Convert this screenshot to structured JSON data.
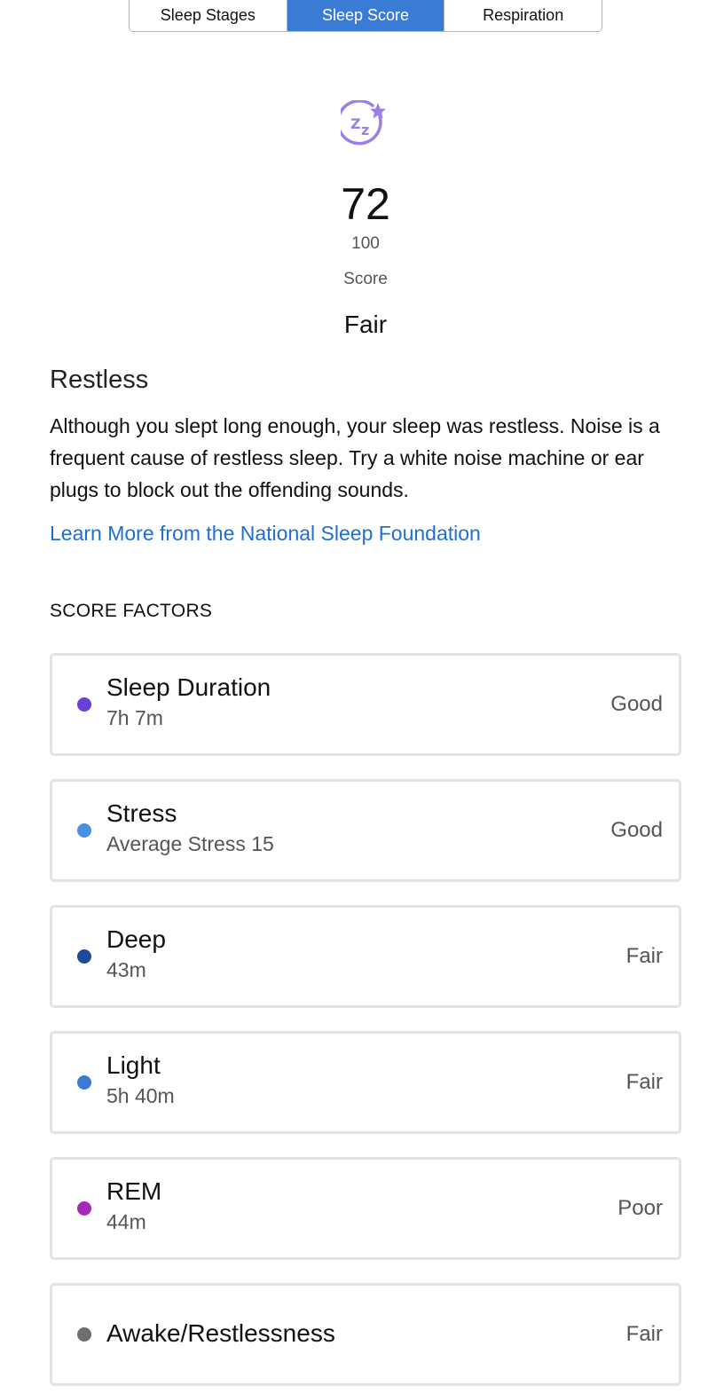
{
  "tabs": [
    {
      "label": "Sleep Stages",
      "active": false
    },
    {
      "label": "Sleep Score",
      "active": true
    },
    {
      "label": "Respiration",
      "active": false
    }
  ],
  "score": {
    "icon": "sleep-zz-star-icon",
    "value": "72",
    "max": "100",
    "label": "Score",
    "quality": "Fair"
  },
  "insight": {
    "title": "Restless",
    "body": "Although you slept long enough, your sleep was restless. Noise is a frequent cause of restless sleep. Try a white noise machine or ear plugs to block out the offending sounds.",
    "link": "Learn More from the National Sleep Foundation"
  },
  "factors": {
    "heading": "SCORE FACTORS",
    "items": [
      {
        "name": "Sleep Duration",
        "detail": "7h 7m",
        "rating": "Good",
        "color": "#6a3fd8"
      },
      {
        "name": "Stress",
        "detail": "Average Stress 15",
        "rating": "Good",
        "color": "#4a90e2"
      },
      {
        "name": "Deep",
        "detail": "43m",
        "rating": "Fair",
        "color": "#1e4a9c"
      },
      {
        "name": "Light",
        "detail": "5h 40m",
        "rating": "Fair",
        "color": "#3a7bd5"
      },
      {
        "name": "REM",
        "detail": "44m",
        "rating": "Poor",
        "color": "#a02bb8"
      },
      {
        "name": "Awake/Restlessness",
        "detail": "",
        "rating": "Fair",
        "color": "#6e6e6e"
      }
    ]
  },
  "colors": {
    "accent": "#3a7bd5",
    "link": "#1f6fd0",
    "icon": "#9b7fe8"
  }
}
